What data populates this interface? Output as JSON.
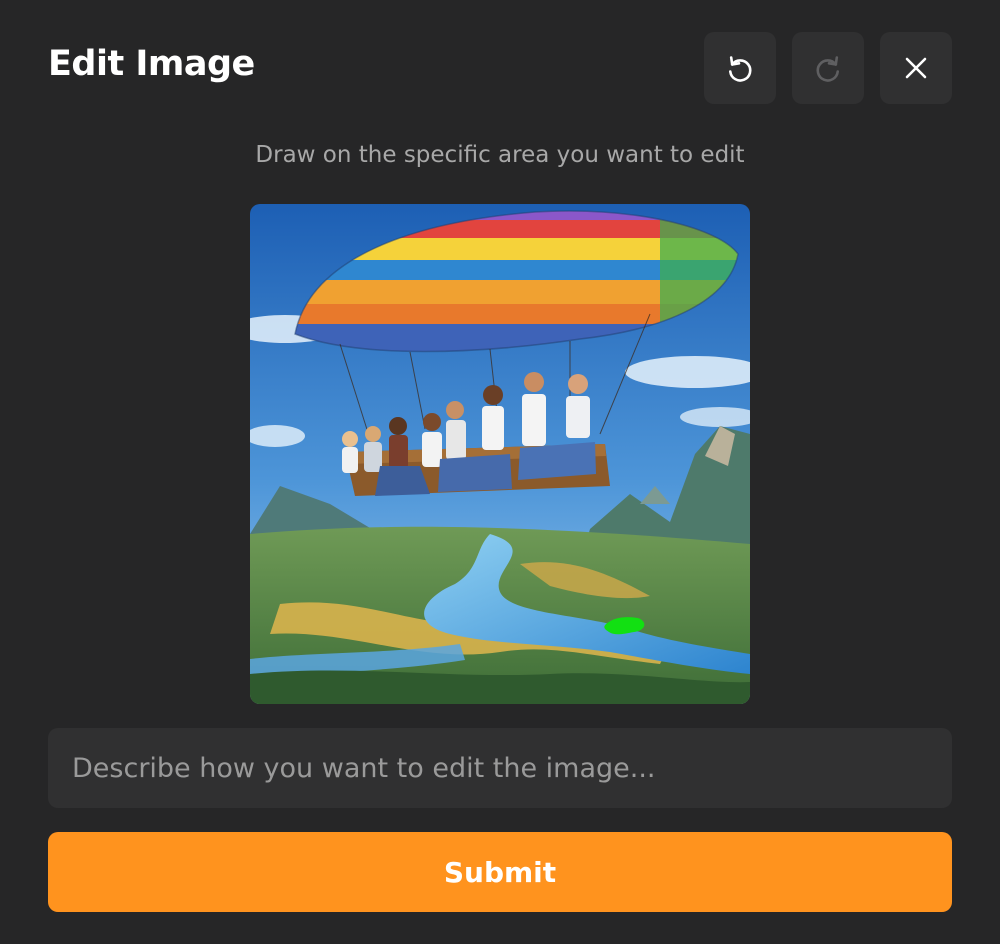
{
  "dialog": {
    "title": "Edit Image",
    "hint": "Draw on the specific area you want to edit"
  },
  "toolbar": {
    "undo_icon": "undo-icon",
    "redo_icon": "redo-icon",
    "close_icon": "close-icon"
  },
  "prompt": {
    "placeholder": "Describe how you want to edit the image...",
    "value": ""
  },
  "submit_label": "Submit",
  "colors": {
    "background": "#262627",
    "button": "#303031",
    "accent": "#ff931e",
    "mask_stroke": "#12e012"
  }
}
